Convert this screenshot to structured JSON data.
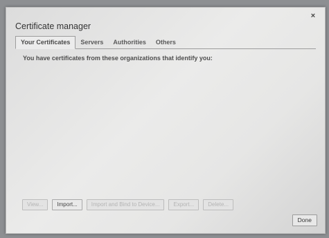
{
  "dialog": {
    "title": "Certificate manager",
    "close_glyph": "×"
  },
  "tabs": [
    {
      "label": "Your Certificates",
      "active": true
    },
    {
      "label": "Servers",
      "active": false
    },
    {
      "label": "Authorities",
      "active": false
    },
    {
      "label": "Others",
      "active": false
    }
  ],
  "panel": {
    "intro_text": "You have certificates from these organizations that identify you:"
  },
  "buttons": {
    "view": "View...",
    "import": "Import...",
    "import_bind": "Import and Bind to Device...",
    "export": "Export...",
    "delete": "Delete...",
    "done": "Done"
  },
  "icons": {
    "close": "close-icon"
  }
}
